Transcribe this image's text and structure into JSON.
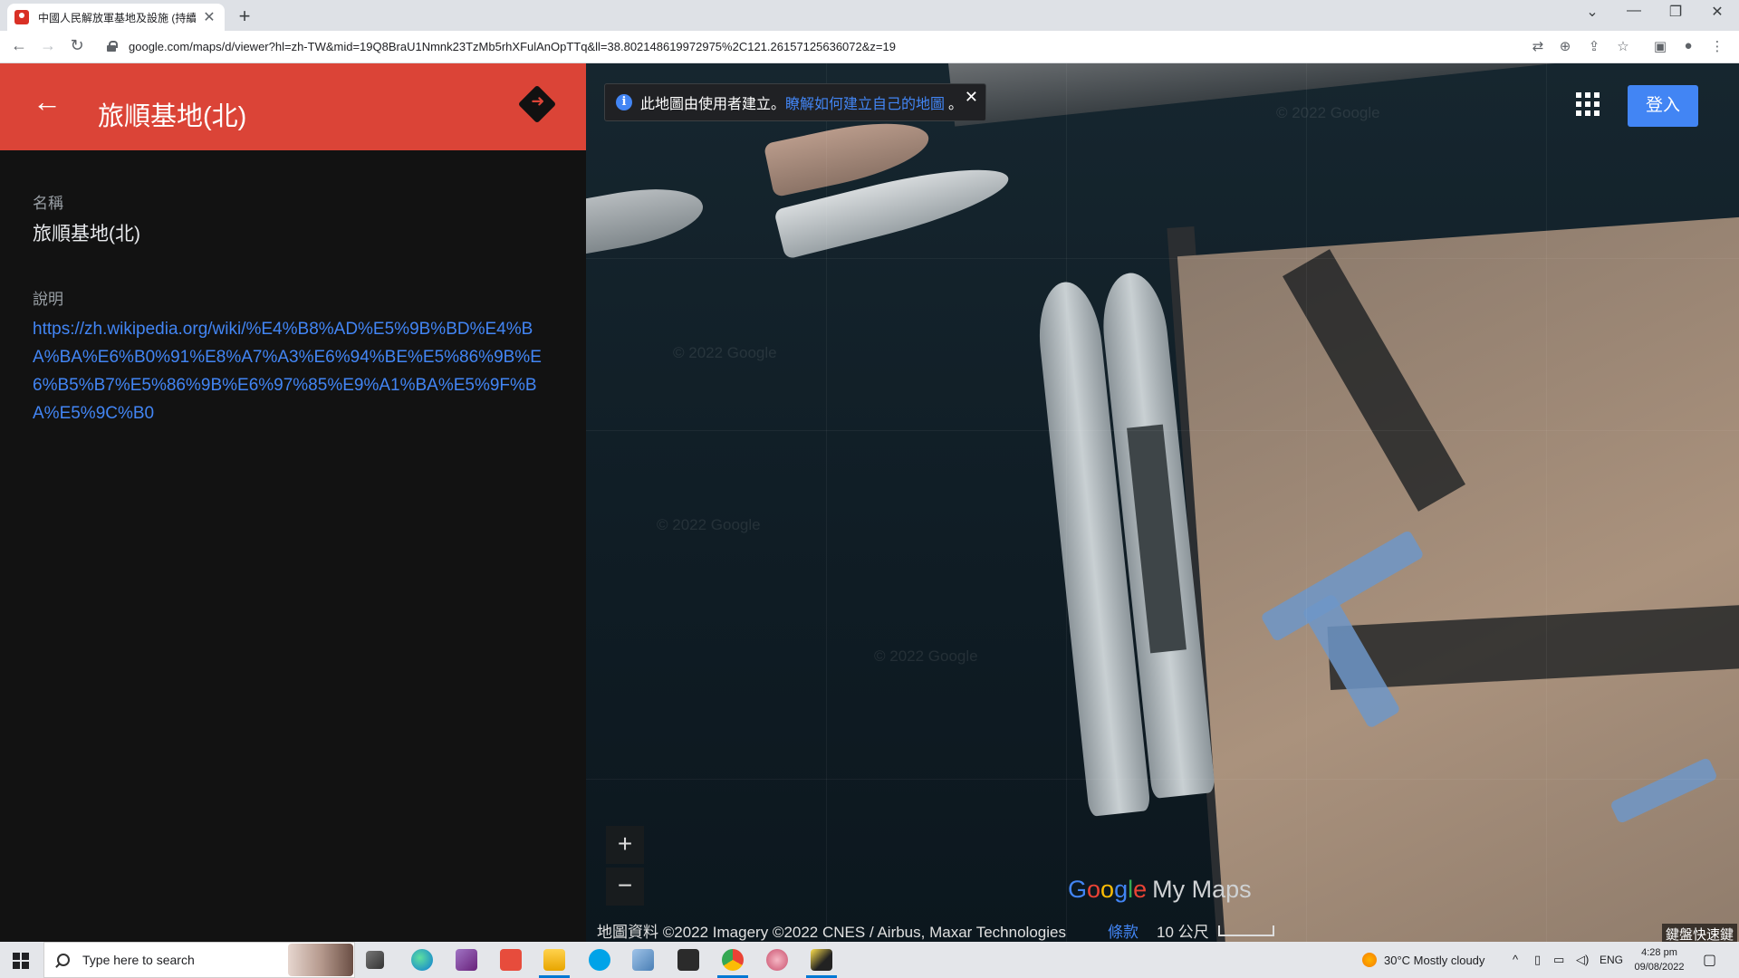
{
  "browser": {
    "tab_title": "中國人民解放軍基地及設施 (持續",
    "tab_close": "✕",
    "new_tab": "+",
    "url": "google.com/maps/d/viewer?hl=zh-TW&mid=19Q8BraU1Nmnk23TzMb5rhXFulAnOpTTq&ll=38.802148619972975%2C121.26157125636072&z=19",
    "window_controls": [
      "⌄",
      "—",
      "❐",
      "✕"
    ],
    "nav": [
      "←",
      "→",
      "↻"
    ],
    "toolbar_icons": [
      "translate-icon",
      "zoom-icon",
      "share-icon",
      "bookmark-icon",
      "sidebar-icon",
      "profile-icon",
      "menu-icon"
    ]
  },
  "panel": {
    "title": "旅順基地(北)",
    "back_icon": "←",
    "name_label": "名稱",
    "name_value": "旅順基地(北)",
    "desc_label": "說明",
    "desc_link": "https://zh.wikipedia.org/wiki/%E4%B8%AD%E5%9B%BD%E4%BA%BA%E6%B0%91%E8%A7%A3%E6%94%BE%E5%86%9B%E6%B5%B7%E5%86%9B%E6%97%85%E9%A1%BA%E5%9F%BA%E5%9C%B0",
    "header_color": "#db4437"
  },
  "map": {
    "banner_text": "此地圖由使用者建立。",
    "banner_link": "瞭解如何建立自己的地圖",
    "banner_end": "。",
    "banner_close": "✕",
    "signin_label": "登入",
    "zoom_in": "+",
    "zoom_out": "−",
    "logo_g": [
      "G",
      "o",
      "o",
      "g",
      "l",
      "e"
    ],
    "logo_suffix": "My Maps",
    "attribution": "地圖資料 ©2022 Imagery ©2022 CNES / Airbus, Maxar Technologies",
    "terms": "條款",
    "scale": "10 公尺",
    "shortcuts": "鍵盤快速鍵",
    "watermark": "© 2022 Google"
  },
  "taskbar": {
    "search_placeholder": "Type here to search",
    "weather": "30°C  Mostly cloudy",
    "lang": "ENG",
    "time": "4:28 pm",
    "date": "09/08/2022",
    "tray_caret": "^"
  }
}
